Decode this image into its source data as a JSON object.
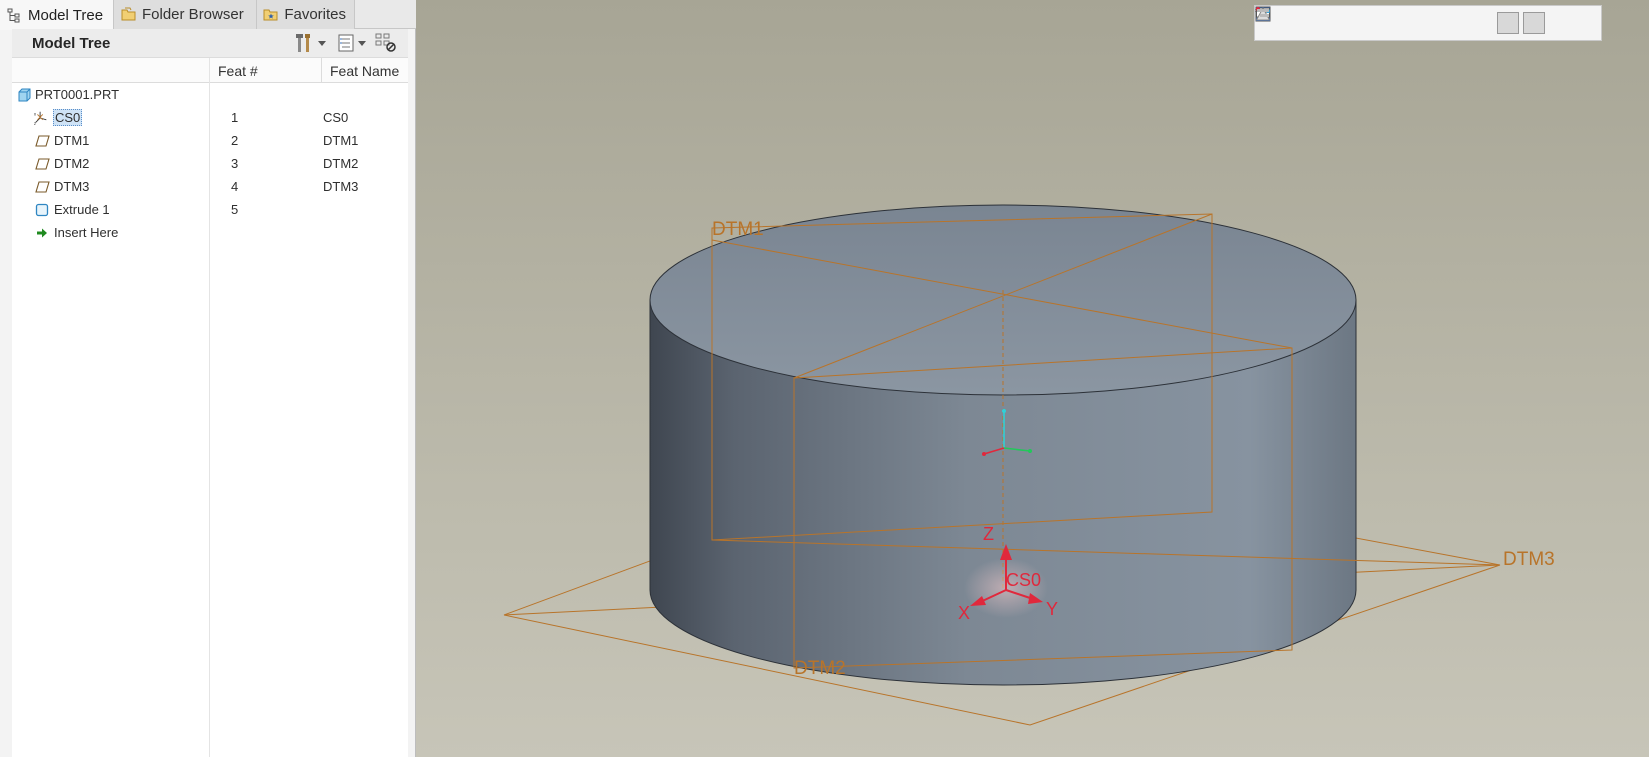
{
  "tabs": [
    {
      "label": "Model Tree",
      "icon": "model-tree-icon",
      "active": true
    },
    {
      "label": "Folder Browser",
      "icon": "folder-browser-icon",
      "active": false
    },
    {
      "label": "Favorites",
      "icon": "favorites-icon",
      "active": false
    }
  ],
  "tree_panel": {
    "title": "Model Tree",
    "toolbar": [
      "settings-icon",
      "dropdown-arrow-icon",
      "show-icon",
      "dropdown-arrow-icon",
      "tree-filter-icon"
    ]
  },
  "columns": {
    "feat_num": "Feat #",
    "feat_name": "Feat Name"
  },
  "tree": {
    "root": {
      "label": "PRT0001.PRT",
      "icon": "part-icon"
    },
    "rows": [
      {
        "label": "CS0",
        "feat_num": "1",
        "feat_name": "CS0",
        "icon": "coordinate-system-icon",
        "selected": true
      },
      {
        "label": "DTM1",
        "feat_num": "2",
        "feat_name": "DTM1",
        "icon": "datum-plane-icon"
      },
      {
        "label": "DTM2",
        "feat_num": "3",
        "feat_name": "DTM2",
        "icon": "datum-plane-icon"
      },
      {
        "label": "DTM3",
        "feat_num": "4",
        "feat_name": "DTM3",
        "icon": "datum-plane-icon"
      },
      {
        "label": "Extrude 1",
        "feat_num": "5",
        "feat_name": "",
        "icon": "extrude-icon"
      },
      {
        "label": "Insert Here",
        "feat_num": "",
        "feat_name": "",
        "icon": "insert-arrow-icon"
      }
    ]
  },
  "viewport": {
    "labels": {
      "dtm1": "DTM1",
      "dtm2": "DTM2",
      "dtm3": "DTM3",
      "cs0": "CS0",
      "axis_x": "X",
      "axis_y": "Y",
      "axis_z": "Z"
    },
    "colors": {
      "datum": "#b8742a",
      "csys": "#e0283c",
      "background_top": "#a7a595",
      "background_bottom": "#c7c5b8",
      "solid": "#7e8a97"
    },
    "toolbar": [
      "refit-icon",
      "zoom-in-icon",
      "zoom-out-icon",
      "repaint-icon",
      "pan-icon",
      "saved-orientations-icon",
      "view-manager-icon",
      "perspective-icon",
      "display-style-icon",
      "datum-display-icon",
      "spin-center-icon",
      "annotation-display-icon",
      "section-icon"
    ]
  }
}
